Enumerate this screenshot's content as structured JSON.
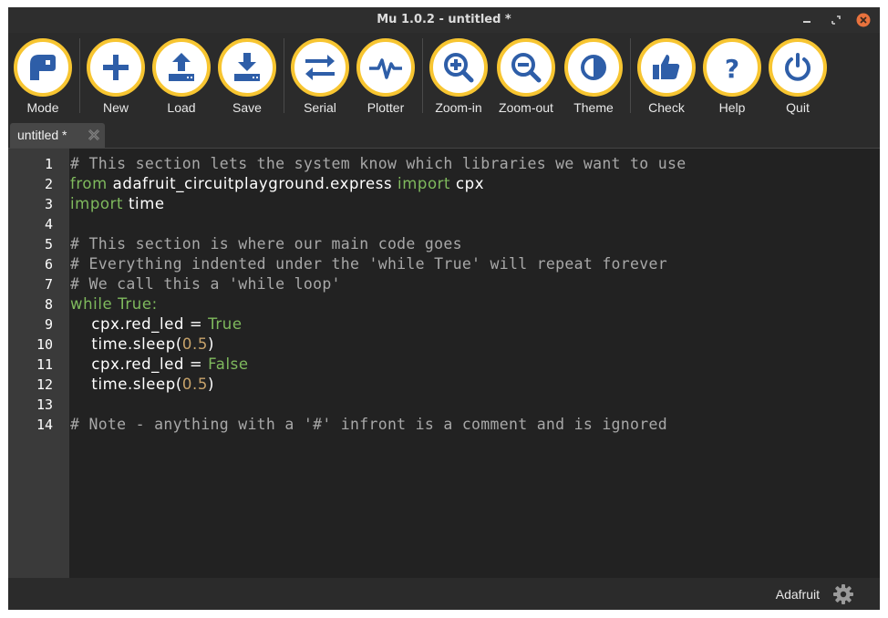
{
  "window": {
    "title": "Mu 1.0.2 - untitled *"
  },
  "toolbar": {
    "buttons": [
      {
        "label": "Mode",
        "icon": "mode-icon"
      },
      {
        "label": "New",
        "icon": "plus-icon"
      },
      {
        "label": "Load",
        "icon": "upload-icon"
      },
      {
        "label": "Save",
        "icon": "download-icon"
      },
      {
        "label": "Serial",
        "icon": "swap-arrows-icon"
      },
      {
        "label": "Plotter",
        "icon": "pulse-icon"
      },
      {
        "label": "Zoom-in",
        "icon": "zoom-in-icon"
      },
      {
        "label": "Zoom-out",
        "icon": "zoom-out-icon"
      },
      {
        "label": "Theme",
        "icon": "half-circle-icon"
      },
      {
        "label": "Check",
        "icon": "thumbs-up-icon"
      },
      {
        "label": "Help",
        "icon": "question-icon"
      },
      {
        "label": "Quit",
        "icon": "power-icon"
      }
    ],
    "accent_color": "#f7c531",
    "icon_color": "#2e5ea8"
  },
  "tabs": [
    {
      "label": "untitled *",
      "active": true
    }
  ],
  "editor": {
    "line_numbers": [
      "1",
      "2",
      "3",
      "4",
      "5",
      "6",
      "7",
      "8",
      "9",
      "10",
      "11",
      "12",
      "13",
      "14"
    ],
    "lines": {
      "l1_comment": "# This section lets the system know which libraries we want to use",
      "l2_from": "from",
      "l2_module": " adafruit_circuitplayground.express ",
      "l2_import": "import",
      "l2_name": " cpx",
      "l3_import": "import",
      "l3_name": " time",
      "l5_comment": "# This section is where our main code goes",
      "l6_comment": "# Everything indented under the 'while True' will repeat forever",
      "l7_comment": "# We call this a 'while loop'",
      "l8_while": "while",
      "l8_true": " True",
      "l8_colon": ":",
      "l9_obj": "    cpx.red_led = ",
      "l9_val": "True",
      "l10_call": "    time.sleep(",
      "l10_num": "0.5",
      "l10_close": ")",
      "l11_obj": "    cpx.red_led = ",
      "l11_val": "False",
      "l12_call": "    time.sleep(",
      "l12_num": "0.5",
      "l12_close": ")",
      "l14_comment": "# Note - anything with a '#' infront is a comment and is ignored"
    }
  },
  "statusbar": {
    "mode_label": "Adafruit",
    "settings_icon": "gear-icon"
  }
}
